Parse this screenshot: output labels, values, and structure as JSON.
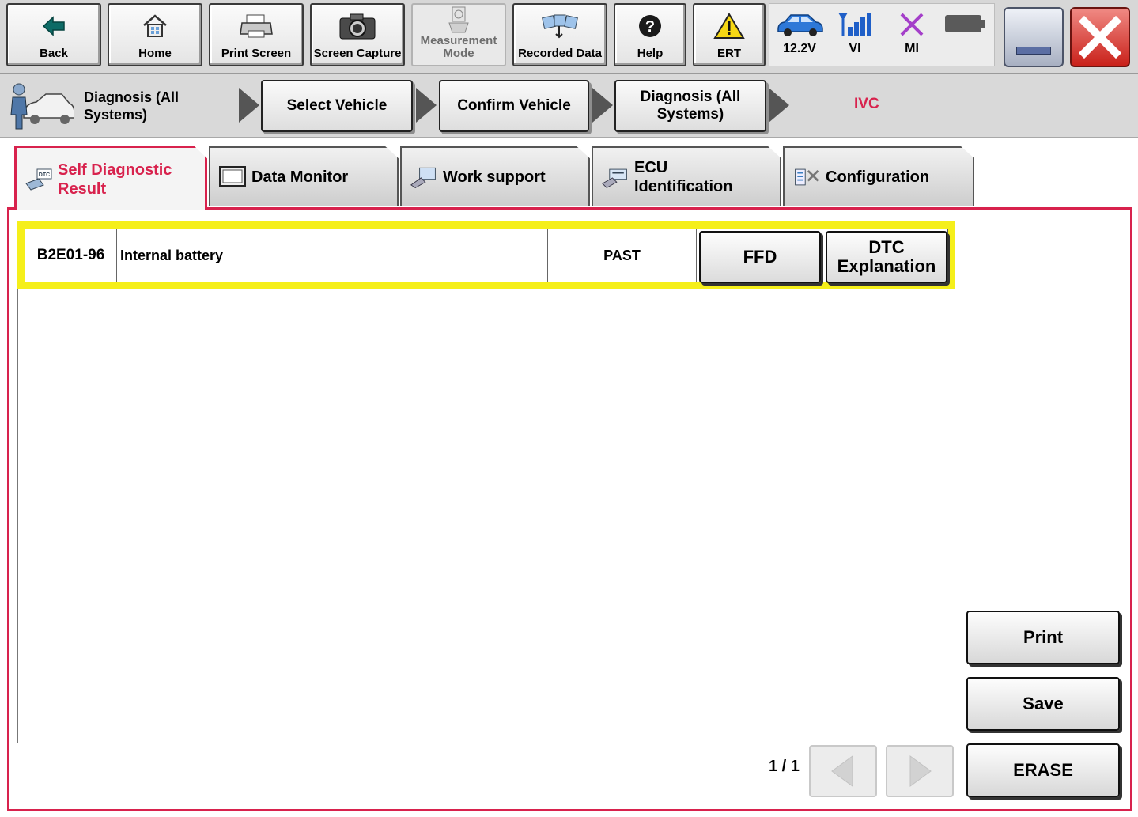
{
  "toolbar": {
    "back": "Back",
    "home": "Home",
    "print_screen": "Print Screen",
    "screen_capture": "Screen Capture",
    "measurement_mode": "Measurement Mode",
    "recorded_data": "Recorded Data",
    "help": "Help",
    "ert": "ERT"
  },
  "status": {
    "voltage": "12.2V",
    "vi": "VI",
    "mi": "MI"
  },
  "breadcrumb": {
    "current": "Diagnosis (All Systems)",
    "step1": "Select Vehicle",
    "step2": "Confirm Vehicle",
    "step3": "Diagnosis (All Systems)",
    "system": "IVC"
  },
  "tabs": [
    {
      "label": "Self Diagnostic Result"
    },
    {
      "label": "Data Monitor"
    },
    {
      "label": "Work support"
    },
    {
      "label": "ECU Identification"
    },
    {
      "label": "Configuration"
    }
  ],
  "dtc": {
    "code": "B2E01-96",
    "description": "Internal battery",
    "status": "PAST",
    "ffd_label": "FFD",
    "explanation_label": "DTC Explanation"
  },
  "actions": {
    "print": "Print",
    "save": "Save",
    "erase": "ERASE"
  },
  "paging": {
    "page": "1 / 1"
  },
  "colors": {
    "accent": "#d8224d",
    "highlight": "#f5ef1a"
  }
}
